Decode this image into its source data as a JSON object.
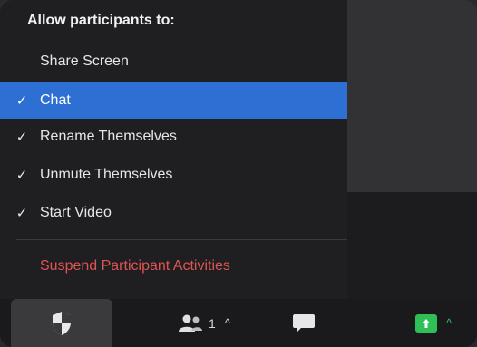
{
  "menu": {
    "header": "Allow participants to:",
    "items": [
      {
        "label": "Share Screen",
        "checked": false,
        "selected": false
      },
      {
        "label": "Chat",
        "checked": true,
        "selected": true
      },
      {
        "label": "Rename Themselves",
        "checked": true,
        "selected": false
      },
      {
        "label": "Unmute Themselves",
        "checked": true,
        "selected": false
      },
      {
        "label": "Start Video",
        "checked": true,
        "selected": false
      }
    ],
    "suspend_label": "Suspend Participant Activities",
    "check_glyph": "✓"
  },
  "toolbar": {
    "participants_count": "1",
    "caret_glyph": "^",
    "icons": [
      "shield-icon",
      "participants-icon",
      "chat-icon",
      "share-screen-icon"
    ]
  },
  "colors": {
    "selected": "#2d6fd2",
    "danger": "#e05353",
    "share": "#2fbf57"
  }
}
